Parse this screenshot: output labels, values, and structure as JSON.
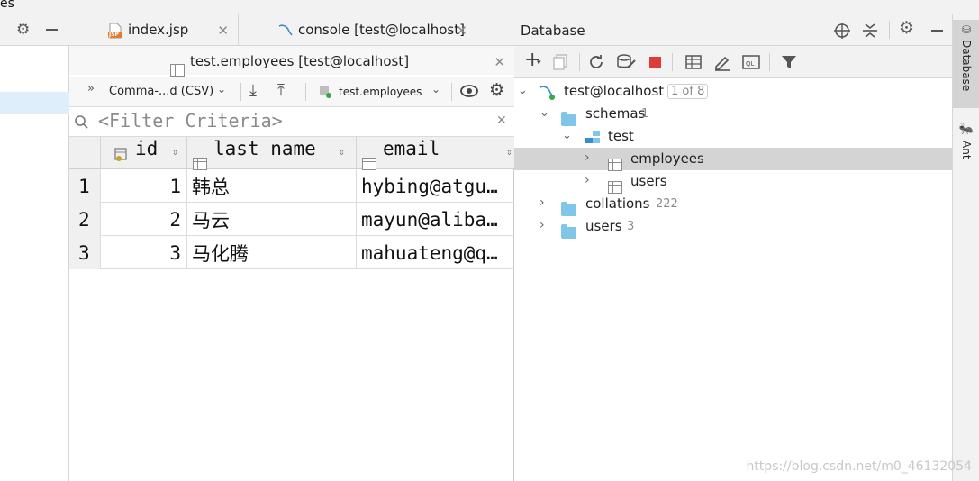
{
  "top_strip": {
    "text": "es"
  },
  "editor": {
    "tabs": [
      {
        "label": "index.jsp",
        "badge": "JSP"
      },
      {
        "label": "console [test@localhost]"
      }
    ],
    "active_tab": {
      "label": "test.employees [test@localhost]"
    },
    "toolbar": {
      "format": "Comma-...d (CSV)",
      "table": "test.employees"
    },
    "filter": {
      "placeholder": "<Filter Criteria>"
    },
    "grid": {
      "columns": [
        "id",
        "last_name",
        "email"
      ],
      "rows": [
        {
          "num": "1",
          "id": "1",
          "last_name": "韩总",
          "email": "hybing@atgu…"
        },
        {
          "num": "2",
          "id": "2",
          "last_name": "马云",
          "email": "mayun@aliba…"
        },
        {
          "num": "3",
          "id": "3",
          "last_name": "马化腾",
          "email": "mahuateng@q…"
        }
      ]
    }
  },
  "database": {
    "title": "Database",
    "tree": {
      "connection": {
        "label": "test@localhost",
        "badge": "1 of 8"
      },
      "schemas": {
        "label": "schemas",
        "count": "1"
      },
      "schema_test": {
        "label": "test"
      },
      "employees": {
        "label": "employees"
      },
      "users_table": {
        "label": "users"
      },
      "collations": {
        "label": "collations",
        "count": "222"
      },
      "users": {
        "label": "users",
        "count": "3"
      }
    }
  },
  "right_stripe": {
    "database_tab": "Database",
    "ant_tab": "Ant"
  },
  "watermark": "https://blog.csdn.net/m0_46132054",
  "colors": {
    "selection": "#d4d4d4",
    "folder": "#7fc6e8",
    "stop": "#db3b3b",
    "left_selection": "#dfeefb"
  }
}
